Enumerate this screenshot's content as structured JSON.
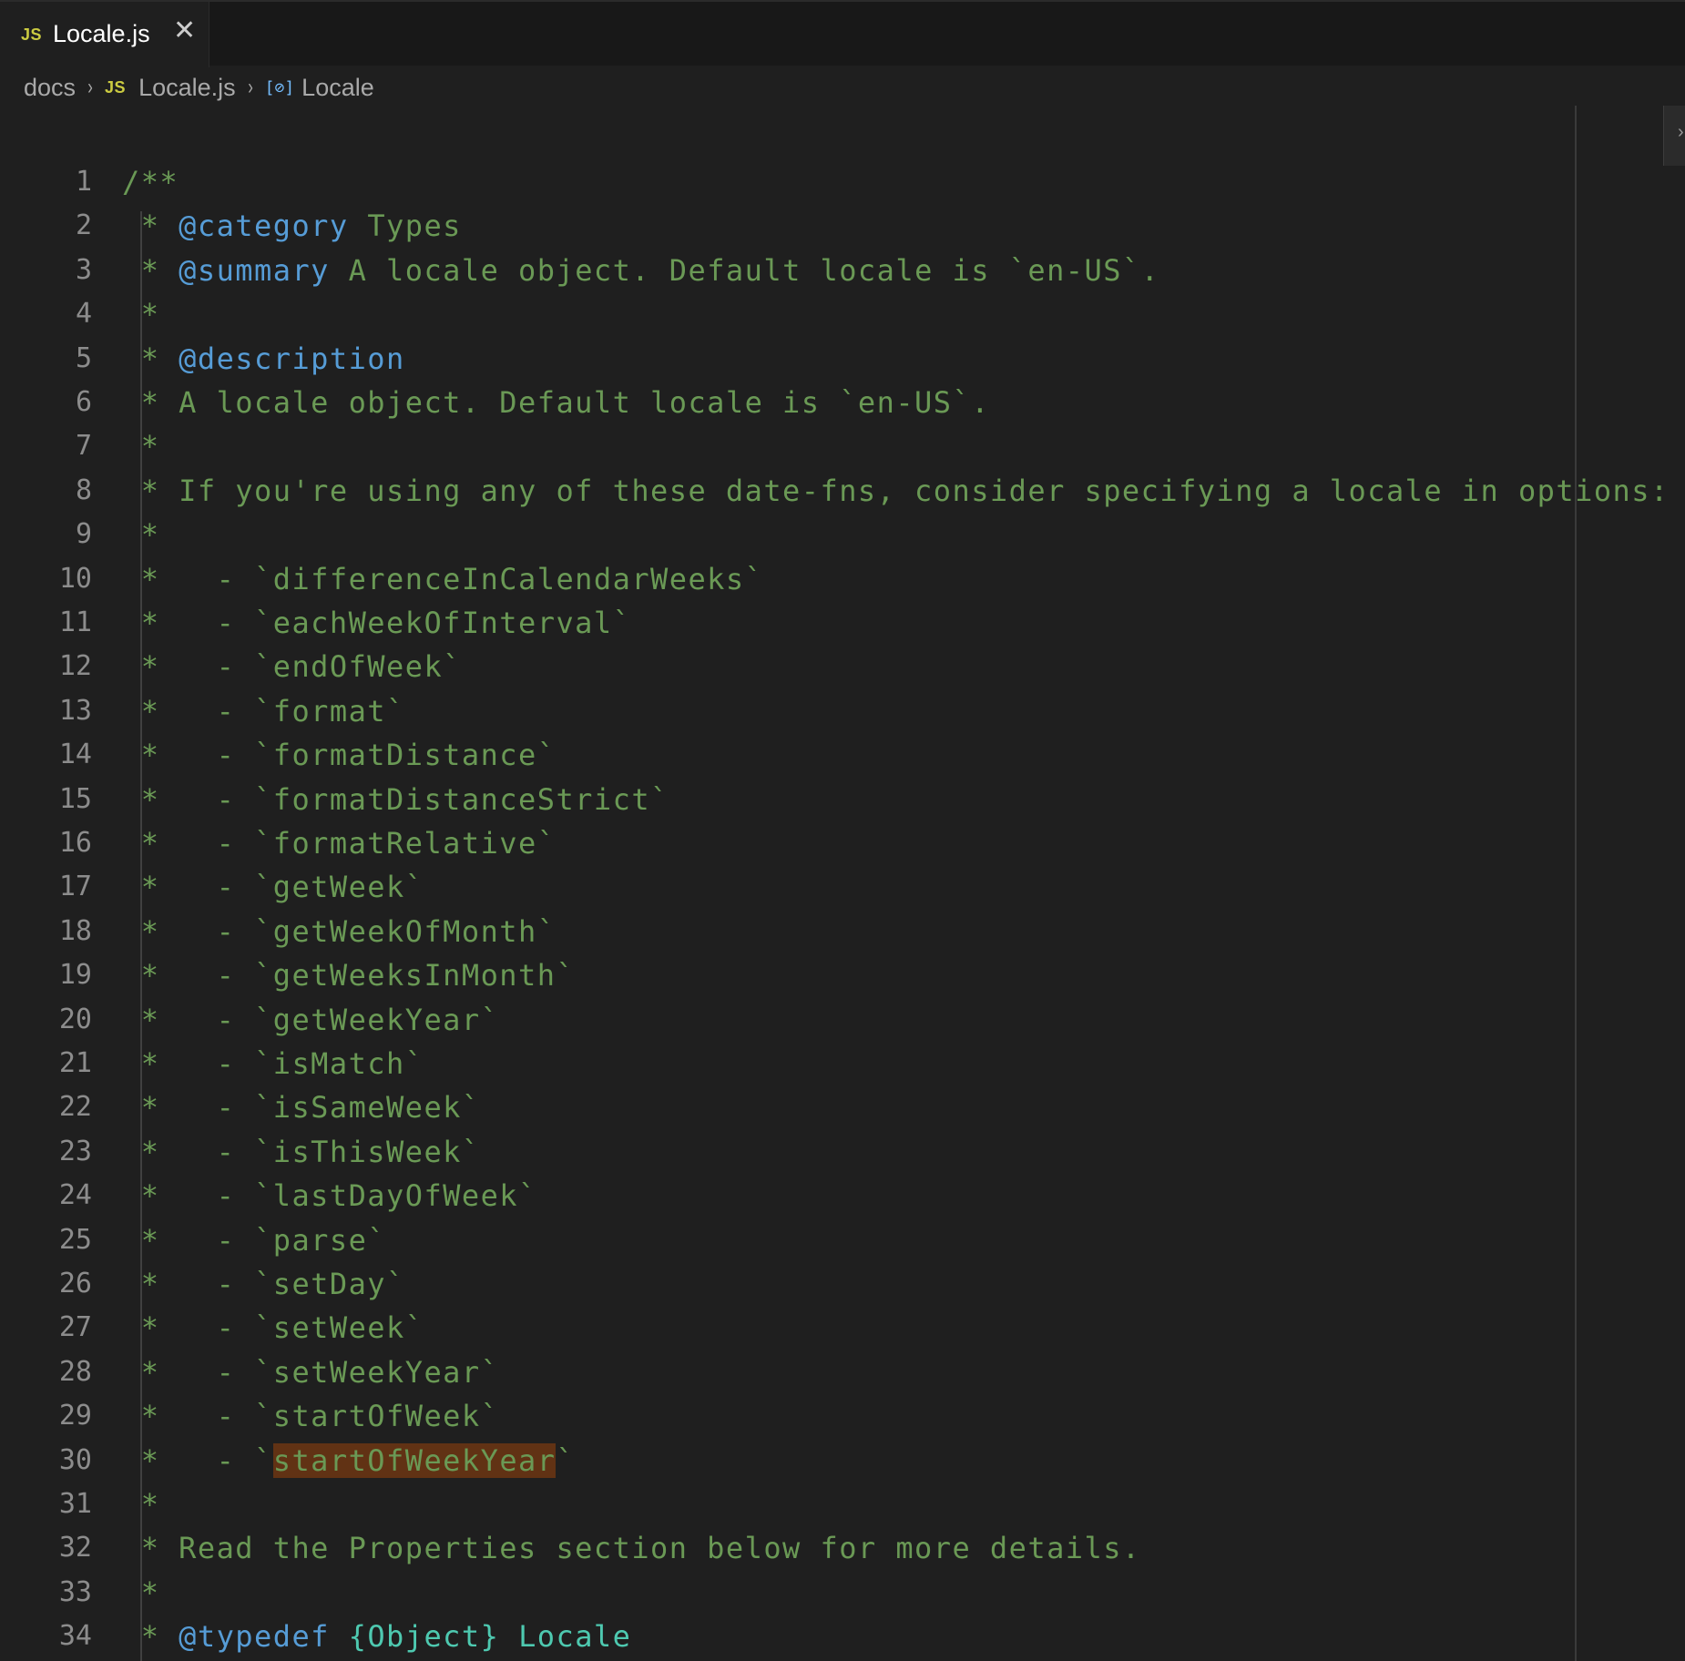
{
  "tab": {
    "badge": "JS",
    "title": "Locale.js",
    "close_glyph": "✕"
  },
  "breadcrumb": {
    "folder": "docs",
    "file_badge": "JS",
    "file": "Locale.js",
    "symbol_icon": "[⊘]",
    "symbol": "Locale",
    "separator": "›"
  },
  "colors": {
    "background": "#1f1f1f",
    "comment": "#6a9955",
    "jsdoc_tag": "#569cd6",
    "type": "#4ec9b0",
    "highlight": "#613214",
    "line_number": "#8c8c8c"
  },
  "lines": [
    {
      "num": "1",
      "segs": [
        {
          "t": "/**"
        }
      ]
    },
    {
      "num": "2",
      "segs": [
        {
          "t": " * "
        },
        {
          "t": "@category",
          "c": "tag"
        },
        {
          "t": " Types"
        }
      ]
    },
    {
      "num": "3",
      "segs": [
        {
          "t": " * "
        },
        {
          "t": "@summary",
          "c": "tag"
        },
        {
          "t": " A locale object. Default locale is `en-US`."
        }
      ]
    },
    {
      "num": "4",
      "segs": [
        {
          "t": " *"
        }
      ]
    },
    {
      "num": "5",
      "segs": [
        {
          "t": " * "
        },
        {
          "t": "@description",
          "c": "tag"
        }
      ]
    },
    {
      "num": "6",
      "segs": [
        {
          "t": " * A locale object. Default locale is `en-US`."
        }
      ]
    },
    {
      "num": "7",
      "segs": [
        {
          "t": " *"
        }
      ]
    },
    {
      "num": "8",
      "segs": [
        {
          "t": " * If you're using any of these date-fns, consider specifying a locale in options:"
        }
      ]
    },
    {
      "num": "9",
      "segs": [
        {
          "t": " *"
        }
      ]
    },
    {
      "num": "10",
      "segs": [
        {
          "t": " *   - `differenceInCalendarWeeks`"
        }
      ]
    },
    {
      "num": "11",
      "segs": [
        {
          "t": " *   - `eachWeekOfInterval`"
        }
      ]
    },
    {
      "num": "12",
      "segs": [
        {
          "t": " *   - `endOfWeek`"
        }
      ]
    },
    {
      "num": "13",
      "segs": [
        {
          "t": " *   - `format`"
        }
      ]
    },
    {
      "num": "14",
      "segs": [
        {
          "t": " *   - `formatDistance`"
        }
      ]
    },
    {
      "num": "15",
      "segs": [
        {
          "t": " *   - `formatDistanceStrict`"
        }
      ]
    },
    {
      "num": "16",
      "segs": [
        {
          "t": " *   - `formatRelative`"
        }
      ]
    },
    {
      "num": "17",
      "segs": [
        {
          "t": " *   - `getWeek`"
        }
      ]
    },
    {
      "num": "18",
      "segs": [
        {
          "t": " *   - `getWeekOfMonth`"
        }
      ]
    },
    {
      "num": "19",
      "segs": [
        {
          "t": " *   - `getWeeksInMonth`"
        }
      ]
    },
    {
      "num": "20",
      "segs": [
        {
          "t": " *   - `getWeekYear`"
        }
      ]
    },
    {
      "num": "21",
      "segs": [
        {
          "t": " *   - `isMatch`"
        }
      ]
    },
    {
      "num": "22",
      "segs": [
        {
          "t": " *   - `isSameWeek`"
        }
      ]
    },
    {
      "num": "23",
      "segs": [
        {
          "t": " *   - `isThisWeek`"
        }
      ]
    },
    {
      "num": "24",
      "segs": [
        {
          "t": " *   - `lastDayOfWeek`"
        }
      ]
    },
    {
      "num": "25",
      "segs": [
        {
          "t": " *   - `parse`"
        }
      ]
    },
    {
      "num": "26",
      "segs": [
        {
          "t": " *   - `setDay`"
        }
      ]
    },
    {
      "num": "27",
      "segs": [
        {
          "t": " *   - `setWeek`"
        }
      ]
    },
    {
      "num": "28",
      "segs": [
        {
          "t": " *   - `setWeekYear`"
        }
      ]
    },
    {
      "num": "29",
      "segs": [
        {
          "t": " *   - `startOfWeek`"
        }
      ]
    },
    {
      "num": "30",
      "segs": [
        {
          "t": " *   - `"
        },
        {
          "t": "startOfWeekYear",
          "c": "hl"
        },
        {
          "t": "`"
        }
      ]
    },
    {
      "num": "31",
      "segs": [
        {
          "t": " *"
        }
      ]
    },
    {
      "num": "32",
      "segs": [
        {
          "t": " * Read the Properties section below for more details."
        }
      ]
    },
    {
      "num": "33",
      "segs": [
        {
          "t": " *"
        }
      ]
    },
    {
      "num": "34",
      "segs": [
        {
          "t": " * "
        },
        {
          "t": "@typedef",
          "c": "tag"
        },
        {
          "t": " "
        },
        {
          "t": "{Object}",
          "c": "type"
        },
        {
          "t": " "
        },
        {
          "t": "Locale",
          "c": "type"
        }
      ]
    }
  ]
}
